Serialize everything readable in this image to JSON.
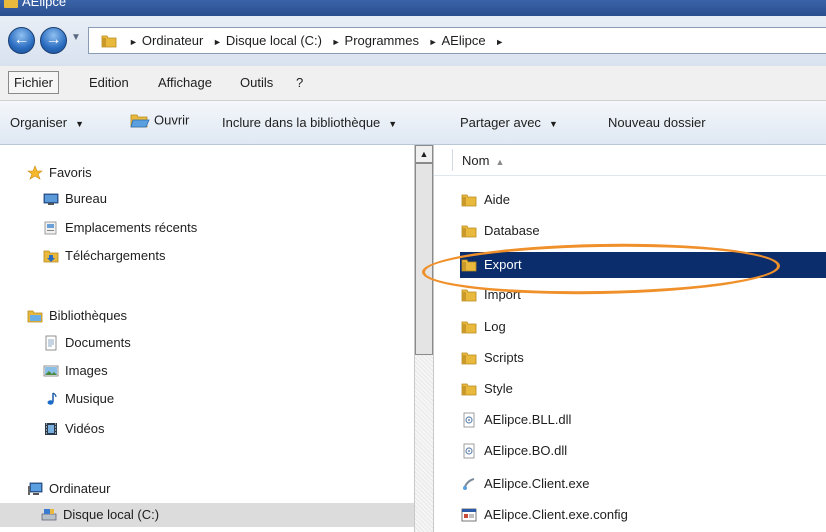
{
  "window": {
    "title": "AElipce"
  },
  "address": {
    "crumbs": [
      "Ordinateur",
      "Disque local (C:)",
      "Programmes",
      "AElipce"
    ]
  },
  "menu": [
    "Fichier",
    "Edition",
    "Affichage",
    "Outils",
    "?"
  ],
  "commands": {
    "organiser": "Organiser",
    "ouvrir": "Ouvrir",
    "inclure": "Inclure dans la bibliothèque",
    "partager": "Partager avec",
    "nouveau": "Nouveau dossier"
  },
  "nav": {
    "favoris": "Favoris",
    "bureau": "Bureau",
    "emplacements": "Emplacements récents",
    "telechargements": "Téléchargements",
    "bibliotheques": "Bibliothèques",
    "documents": "Documents",
    "images": "Images",
    "musique": "Musique",
    "videos": "Vidéos",
    "ordinateur": "Ordinateur",
    "disque": "Disque local (C:)"
  },
  "files": {
    "column_name": "Nom",
    "items": [
      {
        "name": "Aide",
        "type": "folder"
      },
      {
        "name": "Database",
        "type": "folder"
      },
      {
        "name": "Export",
        "type": "folder",
        "selected": true
      },
      {
        "name": "Import",
        "type": "folder"
      },
      {
        "name": "Log",
        "type": "folder"
      },
      {
        "name": "Scripts",
        "type": "folder"
      },
      {
        "name": "Style",
        "type": "folder"
      },
      {
        "name": "AElipce.BLL.dll",
        "type": "dll"
      },
      {
        "name": "AElipce.BO.dll",
        "type": "dll"
      },
      {
        "name": "AElipce.Client.exe",
        "type": "exe"
      },
      {
        "name": "AElipce.Client.exe.config",
        "type": "config"
      }
    ]
  },
  "colors": {
    "selection": "#0c2d6b",
    "annotation": "#f0902a",
    "folder": "#e8b93c"
  }
}
